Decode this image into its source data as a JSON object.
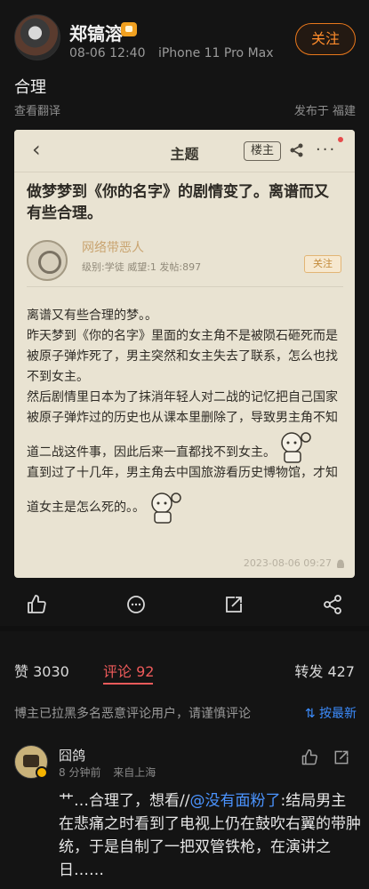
{
  "post": {
    "user_name": "郑镐溶",
    "time": "08-06 12:40",
    "device": "iPhone 11 Pro Max",
    "follow_label": "关注",
    "text": "合理",
    "translate_label": "查看翻译",
    "location": "发布于 福建"
  },
  "card": {
    "back_label": "‹",
    "title": "主题",
    "op_tag": "楼主",
    "more_label": "···",
    "headline": "做梦梦到《你的名字》的剧情变了。离谱而又有些合理。",
    "author": {
      "name": "网络带恶人",
      "stats": "级别:学徒   威望:1   发帖:897",
      "follow_label": "关注"
    },
    "body_lines": [
      "离谱又有些合理的梦。。",
      "昨天梦到《你的名字》里面的女主角不是被陨石砸死而是",
      "被原子弹炸死了，男主突然和女主失去了联系，怎么也找",
      "不到女主。",
      "然后剧情里日本为了抹消年轻人对二战的记忆把自己国家",
      "被原子弹炸过的历史也从课本里删除了，导致男主角不知",
      "道二战这件事，因此后来一直都找不到女主。",
      "直到过了十几年，男主角去中国旅游看历史博物馆，才知",
      "道女主是怎么死的。。"
    ],
    "timestamp": "2023-08-06 09:27"
  },
  "stats": {
    "likes": "赞 3030",
    "comments": "评论 92",
    "reposts": "转发 427"
  },
  "notice": {
    "text": "博主已拉黑多名恶意评论用户，请谨慎评论",
    "sort_label": "按最新"
  },
  "comment": {
    "name": "囧鸽",
    "time": "8 分钟前",
    "source": "来自上海",
    "text_prefix": "艹…合理了，想看//",
    "mention": "@没有面粉了",
    "text_suffix": ":结局男主在悲痛之时看到了电视上仍在鼓吹右翼的带肿统，于是自制了一把双管铁枪，在演讲之日……"
  },
  "colors": {
    "accent_orange": "#ff8c2b",
    "comment_red": "#ef5b5b",
    "link_blue": "#3c8dff",
    "card_bg": "#e9e3d2"
  }
}
